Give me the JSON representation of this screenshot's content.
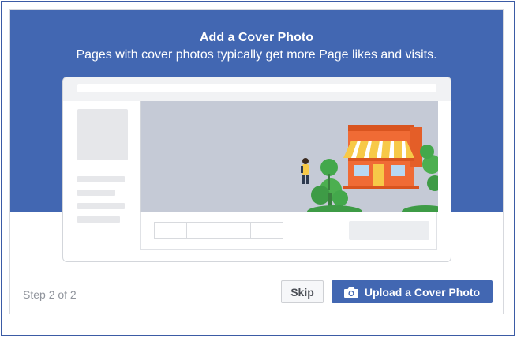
{
  "dialog": {
    "title": "Add a Cover Photo",
    "subtitle": "Pages with cover photos typically get more Page likes and visits."
  },
  "illustration": {
    "icons": [
      "storefront-illustration",
      "person-illustration",
      "tree-illustration"
    ]
  },
  "footer": {
    "step_text": "Step 2 of 2",
    "skip_label": "Skip",
    "upload_label": "Upload a Cover Photo",
    "upload_icon": "camera-icon"
  },
  "colors": {
    "brand_blue": "#4267b2",
    "cover_gray": "#c5cad6",
    "store_orange": "#f06b35",
    "awning_yellow": "#f7c948",
    "tree_green": "#4caf50"
  }
}
